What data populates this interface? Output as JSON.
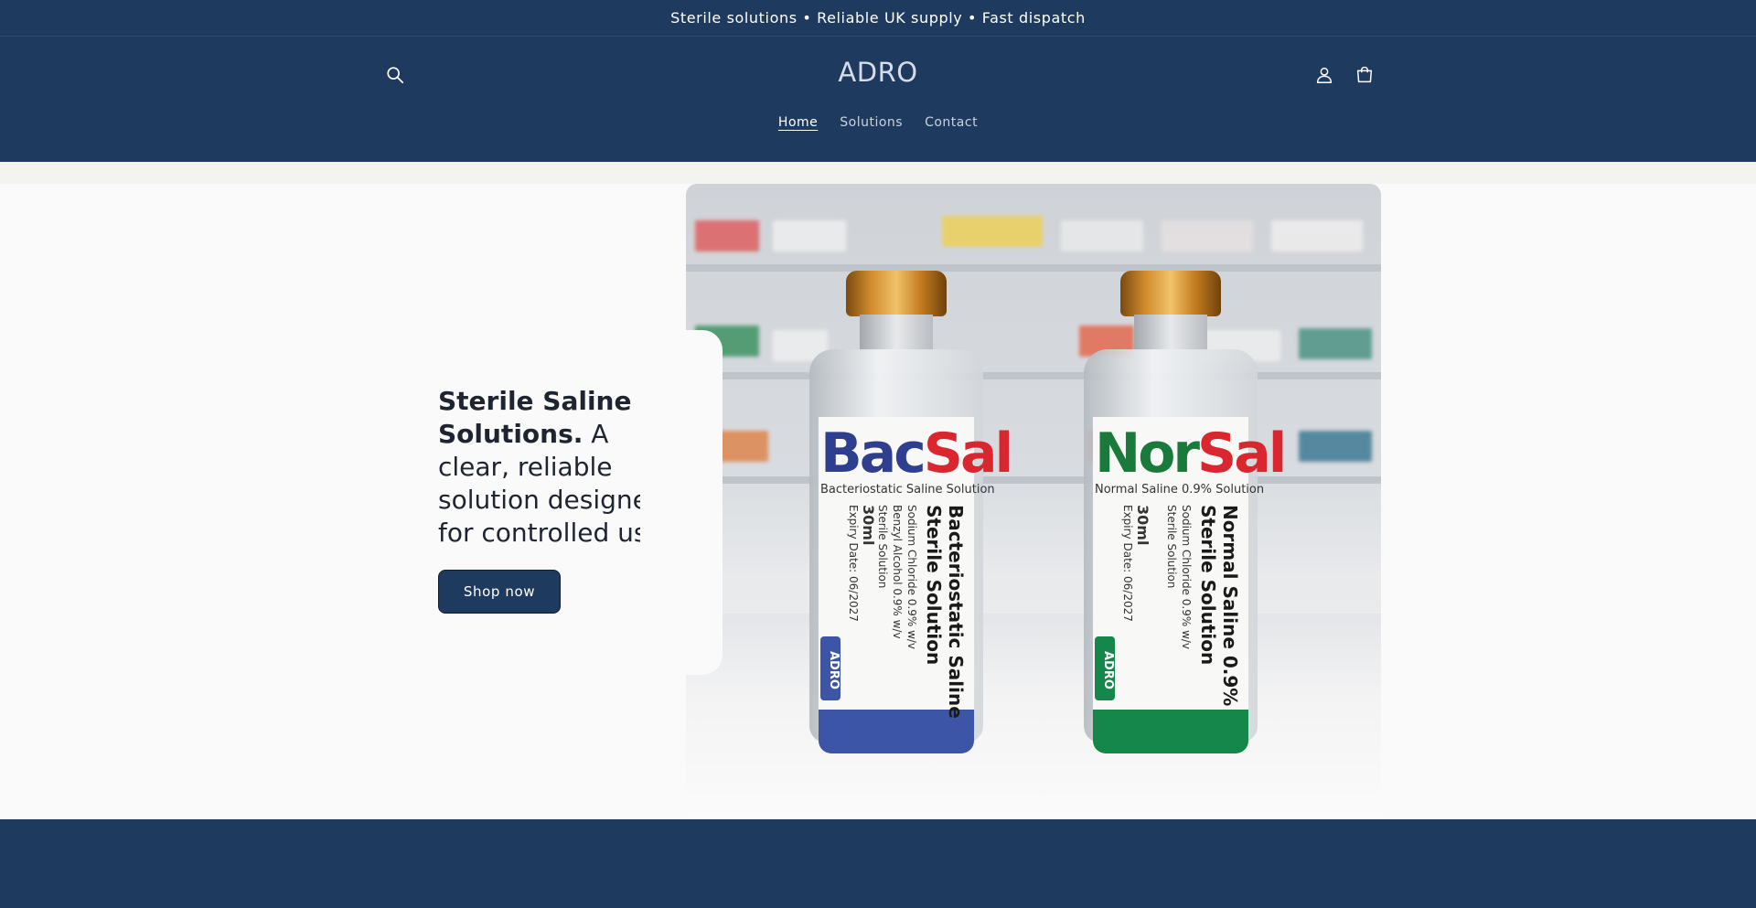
{
  "announcement": {
    "text": "Sterile solutions • Reliable UK supply • Fast dispatch"
  },
  "header": {
    "logo": "ADRO",
    "icons": {
      "search": "search-icon",
      "account": "user-icon",
      "cart": "cart-icon"
    },
    "nav": [
      {
        "label": "Home",
        "active": true
      },
      {
        "label": "Solutions",
        "active": false
      },
      {
        "label": "Contact",
        "active": false
      }
    ]
  },
  "hero": {
    "heading_bold": "Sterile Saline Solutions.",
    "heading_rest": " A clear, reliable solution designed for controlled use.",
    "button_label": "Shop now",
    "image": {
      "vial_left": {
        "brand_a": "Bac",
        "brand_b": "Sal",
        "subtitle": "Bacteriostatic Saline Solution",
        "title_line1": "Bacteriostatic Saline",
        "title_line2": "Sterile Solution",
        "info_line1": "Sodium Chloride 0.9% w/v",
        "info_line2": "Benzyl Alcohol 0.9% w/v",
        "info_line3": "Sterile Solution",
        "volume": "30ml",
        "expiry": "Expiry Date: 06/2027",
        "mark": "ADRO",
        "band_color": "#3d55a6"
      },
      "vial_right": {
        "brand_a": "Nor",
        "brand_b": "Sal",
        "subtitle": "Normal Saline 0.9% Solution",
        "title_line1": "Normal Saline 0.9%",
        "title_line2": "Sterile Solution",
        "info_line1": "Sodium Chloride 0.9% w/v",
        "info_line2": "Sterile Solution",
        "volume": "30ml",
        "expiry": "Expiry Date: 06/2027",
        "mark": "ADRO",
        "band_color": "#15874a"
      }
    }
  },
  "colors": {
    "primary": "#1f3a5f",
    "hero_bg": "#fafafa",
    "stripe": "#f3f3ef",
    "text_dark": "#1e2430",
    "brand_red": "#d9262f",
    "brand_blue": "#2f3f8f",
    "brand_green": "#1a7a3c"
  }
}
